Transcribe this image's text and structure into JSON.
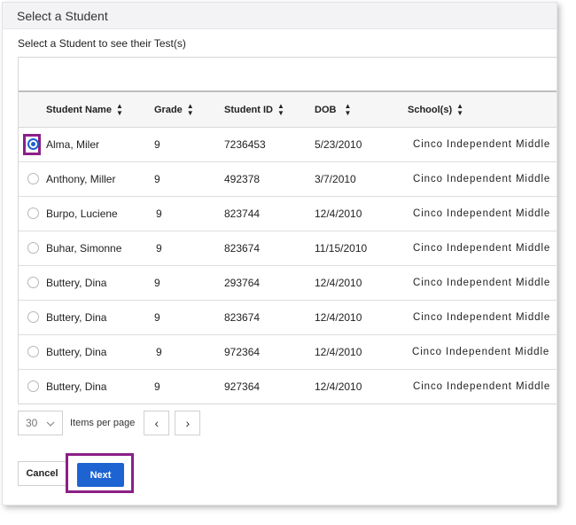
{
  "dialog": {
    "title": "Select a Student",
    "subtitle": "Select a Student to see their Test(s)"
  },
  "table": {
    "columns": [
      "Student Name",
      "Grade",
      "Student ID",
      "DOB",
      "School(s)"
    ],
    "rows": [
      {
        "name": "Alma, Miler",
        "grade": "9",
        "id": "7236453",
        "dob": "5/23/2010",
        "school": "Cinco Independent Middle",
        "selected": true
      },
      {
        "name": "Anthony, Miller",
        "grade": "9",
        "id": "492378",
        "dob": "3/7/2010",
        "school": "Cinco Independent Middle",
        "selected": false
      },
      {
        "name": "Burpo, Luciene",
        "grade": "9",
        "id": "823744",
        "dob": "12/4/2010",
        "school": "Cinco Independent Middle",
        "selected": false
      },
      {
        "name": "Buhar, Simonne",
        "grade": "9",
        "id": "823674",
        "dob": "11/15/2010",
        "school": "Cinco Independent Middle",
        "selected": false
      },
      {
        "name": "Buttery, Dina",
        "grade": "9",
        "id": "293764",
        "dob": "12/4/2010",
        "school": "Cinco Independent Middle",
        "selected": false
      },
      {
        "name": "Buttery, Dina",
        "grade": "9",
        "id": "823674",
        "dob": "12/4/2010",
        "school": "Cinco Independent Middle",
        "selected": false
      },
      {
        "name": "Buttery, Dina",
        "grade": "9",
        "id": "972364",
        "dob": "12/4/2010",
        "school": "Cinco Independent Middle",
        "selected": false
      },
      {
        "name": "Buttery, Dina",
        "grade": "9",
        "id": "927364",
        "dob": "12/4/2010",
        "school": "Cinco Independent Middle",
        "selected": false
      }
    ]
  },
  "pagination": {
    "per_page_value": "30",
    "per_page_label": "Items per page",
    "prev_glyph": "‹",
    "next_glyph": "›"
  },
  "actions": {
    "cancel_label": "Cancel",
    "next_label": "Next"
  },
  "colors": {
    "accent": "#1e63d2",
    "highlight": "#8b1f86"
  },
  "icons": {
    "sort": "sort-icon",
    "dropdown": "chevron-down-icon"
  }
}
